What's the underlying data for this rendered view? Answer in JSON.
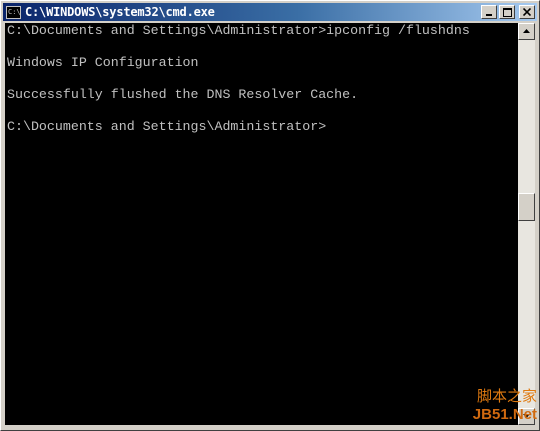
{
  "window": {
    "title": "C:\\WINDOWS\\system32\\cmd.exe",
    "app_icon_text": "C:\\",
    "buttons": {
      "minimize": "_",
      "maximize": "□",
      "close": "✕"
    }
  },
  "console": {
    "lines": [
      "C:\\Documents and Settings\\Administrator>ipconfig /flushdns",
      "",
      "Windows IP Configuration",
      "",
      "Successfully flushed the DNS Resolver Cache.",
      "",
      "C:\\Documents and Settings\\Administrator>"
    ],
    "text_color": "#c0c0c0",
    "background_color": "#000000"
  },
  "scrollbar": {
    "position_fraction": 0.45
  },
  "watermark": {
    "top_text": "脚本之家",
    "bottom_text": "JB51.Net"
  },
  "colors": {
    "titlebar_start": "#0a246a",
    "titlebar_end": "#a6caf0",
    "chrome": "#d4d0c8"
  }
}
